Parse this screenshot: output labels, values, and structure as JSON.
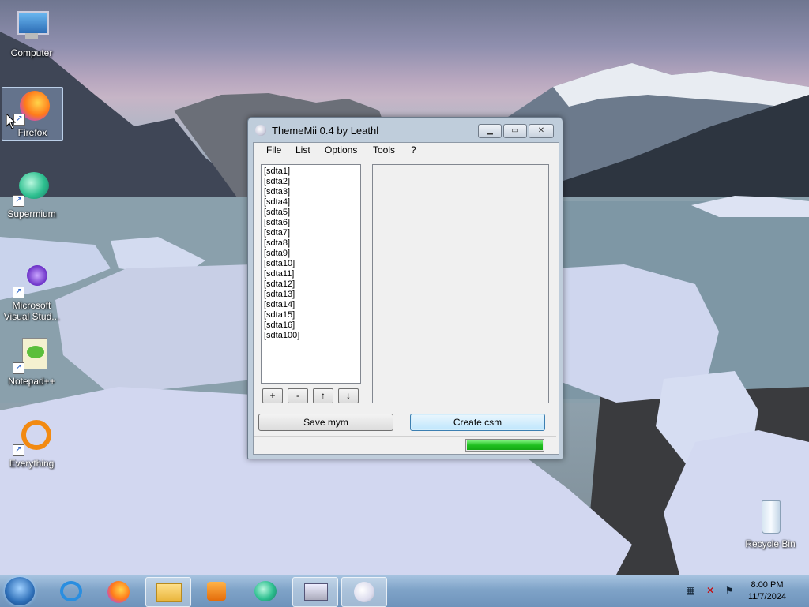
{
  "desktop": {
    "icons": [
      {
        "label": "Computer"
      },
      {
        "label": "Firefox"
      },
      {
        "label": "Supermium"
      },
      {
        "label": "Microsoft Visual Stud..."
      },
      {
        "label": "Notepad++"
      },
      {
        "label": "Everything"
      },
      {
        "label": "Recycle Bin"
      }
    ]
  },
  "window": {
    "title": "ThemeMii 0.4 by Leathl",
    "menu": [
      "File",
      "List",
      "Options",
      "Tools",
      "?"
    ],
    "list_items": [
      "[sdta1]",
      "[sdta2]",
      "[sdta3]",
      "[sdta4]",
      "[sdta5]",
      "[sdta6]",
      "[sdta7]",
      "[sdta8]",
      "[sdta9]",
      "[sdta10]",
      "[sdta11]",
      "[sdta12]",
      "[sdta13]",
      "[sdta14]",
      "[sdta15]",
      "[sdta16]",
      "[sdta100]"
    ],
    "buttons": {
      "add": "+",
      "remove": "-",
      "up": "↑",
      "down": "↓",
      "save": "Save mym",
      "create": "Create csm"
    },
    "progress_percent": 100,
    "colors": {
      "progress": "#20c020",
      "accent": "#3c7fb1"
    }
  },
  "taskbar": {
    "clock_time": "8:00 PM",
    "clock_date": "11/7/2024"
  }
}
